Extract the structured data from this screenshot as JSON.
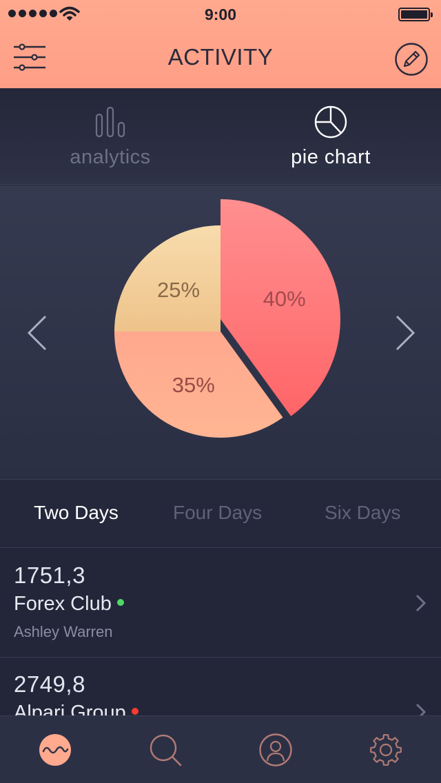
{
  "status_bar": {
    "time": "9:00",
    "icons": [
      "signal-dots-icon",
      "wifi-icon",
      "battery-icon"
    ]
  },
  "header": {
    "title": "ACTIVITY",
    "left_icon": "sliders-icon",
    "right_icon": "pencil-icon"
  },
  "view_tabs": [
    {
      "label": "analytics",
      "icon": "bar-chart-icon",
      "active": false
    },
    {
      "label": "pie chart",
      "icon": "pie-chart-icon",
      "active": true
    }
  ],
  "chart_data": {
    "type": "pie",
    "title": "",
    "slices": [
      {
        "label": "40%",
        "value": 40,
        "color_top": "#ff8f8f",
        "color_bottom": "#ff6568"
      },
      {
        "label": "35%",
        "value": 35,
        "color_top": "#ffa88e",
        "color_bottom": "#ffb593"
      },
      {
        "label": "25%",
        "value": 25,
        "color_top": "#f8dcad",
        "color_bottom": "#eec38a"
      }
    ],
    "label_colors": [
      "#a34a4e",
      "#9a4a44",
      "#8a6a4a"
    ]
  },
  "chart_nav": {
    "prev_icon": "chevron-left-icon",
    "next_icon": "chevron-right-icon"
  },
  "period_tabs": [
    {
      "label": "Two Days",
      "active": true
    },
    {
      "label": "Four Days",
      "active": false
    },
    {
      "label": "Six Days",
      "active": false
    }
  ],
  "activity_list": [
    {
      "amount": "1751,3",
      "company": "Forex Club",
      "status_color": "#4cd964",
      "person": "Ashley Warren"
    },
    {
      "amount": "2749,8",
      "company": "Alpari Group",
      "status_color": "#ff3b30",
      "person": ""
    }
  ],
  "tab_bar": [
    {
      "name": "activity",
      "icon": "wave-icon",
      "active": true
    },
    {
      "name": "search",
      "icon": "search-icon",
      "active": false
    },
    {
      "name": "profile",
      "icon": "user-icon",
      "active": false
    },
    {
      "name": "settings",
      "icon": "gear-icon",
      "active": false
    }
  ],
  "colors": {
    "accent": "#ffa98f",
    "background": "#232639",
    "inactive_icon": "#6c7186",
    "tab_icon": "#b07b74"
  }
}
